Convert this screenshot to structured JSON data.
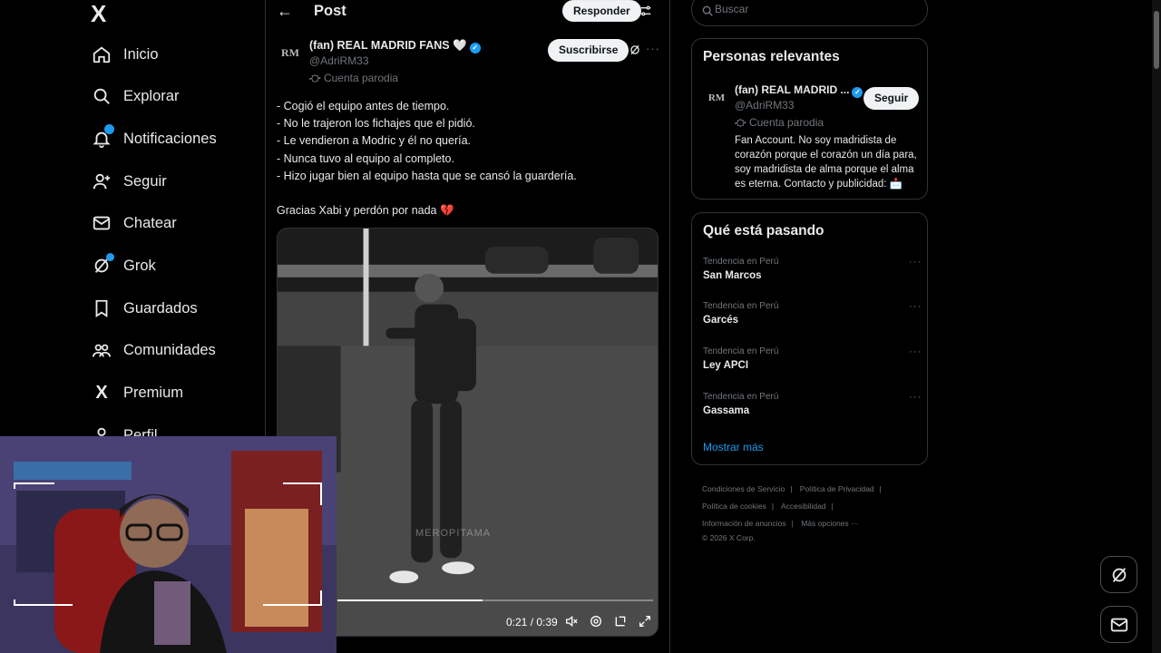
{
  "nav": {
    "logo": "X",
    "items": [
      {
        "label": "Inicio",
        "icon": "home-icon"
      },
      {
        "label": "Explorar",
        "icon": "search-icon"
      },
      {
        "label": "Notificaciones",
        "icon": "bell-icon"
      },
      {
        "label": "Seguir",
        "icon": "add-user-icon"
      },
      {
        "label": "Chatear",
        "icon": "mail-icon"
      },
      {
        "label": "Grok",
        "icon": "grok-icon"
      },
      {
        "label": "Guardados",
        "icon": "bookmark-icon"
      },
      {
        "label": "Comunidades",
        "icon": "communities-icon"
      },
      {
        "label": "Premium",
        "icon": "x-icon"
      },
      {
        "label": "Perfil",
        "icon": "profile-icon"
      }
    ]
  },
  "header": {
    "title": "Post",
    "reply_label": "Responder"
  },
  "post": {
    "avatar_text": "RM",
    "author_name": "(fan) REAL MADRID FANS 🤍",
    "handle": "@AdriRM33",
    "parody_label": "Cuenta parodia",
    "subscribe_label": "Suscribirse",
    "lines": [
      "- Cogió el equipo antes de tiempo.",
      "- No le trajeron los fichajes que el pidió.",
      "- Le vendieron a Modric y él no quería.",
      "- Nunca tuvo al equipo al completo.",
      "- Hizo jugar bien al equipo hasta que se cansó la guardería."
    ],
    "closing": "Gracias Xabi y perdón por nada 💔"
  },
  "video": {
    "time": "0:21 / 0:39",
    "progress": 0.46,
    "watermark": "MEROPITAMA"
  },
  "search": {
    "placeholder": "Buscar"
  },
  "relevant": {
    "title": "Personas relevantes",
    "avatar_text": "RM",
    "name": "(fan) REAL MADRID ...",
    "handle": "@AdriRM33",
    "parody_label": "Cuenta parodia",
    "follow_label": "Seguir",
    "bio": "Fan Account. No soy madridista de corazón porque el corazón un día para, soy madridista de alma porque el alma es eterna. Contacto y publicidad: 📩"
  },
  "trends": {
    "title": "Qué está pasando",
    "items": [
      {
        "meta": "Tendencia en Perú",
        "name": "San Marcos"
      },
      {
        "meta": "Tendencia en Perú",
        "name": "Garcés"
      },
      {
        "meta": "Tendencia en Perú",
        "name": "Ley APCI"
      },
      {
        "meta": "Tendencia en Perú",
        "name": "Gassama"
      }
    ],
    "show_more": "Mostrar más"
  },
  "footer": {
    "links": [
      "Condiciones de Servicio",
      "Política de Privacidad",
      "Política de cookies",
      "Accesibilidad",
      "Información de anuncios",
      "Más opciones ···"
    ],
    "copyright": "© 2026 X Corp."
  },
  "colors": {
    "accent": "#1d9bf0",
    "background": "#000000",
    "border": "#2f3336",
    "muted": "#71767b"
  }
}
